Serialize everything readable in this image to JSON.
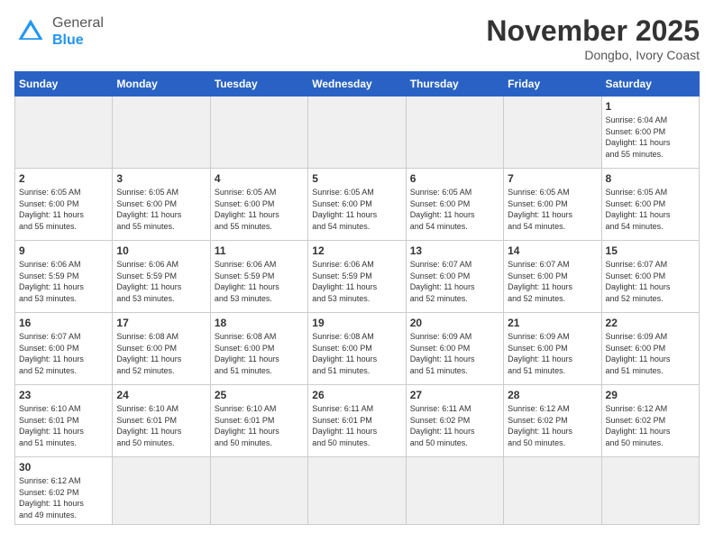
{
  "header": {
    "logo_general": "General",
    "logo_blue": "Blue",
    "month_title": "November 2025",
    "subtitle": "Dongbo, Ivory Coast"
  },
  "days_of_week": [
    "Sunday",
    "Monday",
    "Tuesday",
    "Wednesday",
    "Thursday",
    "Friday",
    "Saturday"
  ],
  "weeks": [
    [
      {
        "day": "",
        "info": "",
        "empty": true
      },
      {
        "day": "",
        "info": "",
        "empty": true
      },
      {
        "day": "",
        "info": "",
        "empty": true
      },
      {
        "day": "",
        "info": "",
        "empty": true
      },
      {
        "day": "",
        "info": "",
        "empty": true
      },
      {
        "day": "",
        "info": "",
        "empty": true
      },
      {
        "day": "1",
        "info": "Sunrise: 6:04 AM\nSunset: 6:00 PM\nDaylight: 11 hours\nand 55 minutes.",
        "empty": false
      }
    ],
    [
      {
        "day": "2",
        "info": "Sunrise: 6:05 AM\nSunset: 6:00 PM\nDaylight: 11 hours\nand 55 minutes.",
        "empty": false
      },
      {
        "day": "3",
        "info": "Sunrise: 6:05 AM\nSunset: 6:00 PM\nDaylight: 11 hours\nand 55 minutes.",
        "empty": false
      },
      {
        "day": "4",
        "info": "Sunrise: 6:05 AM\nSunset: 6:00 PM\nDaylight: 11 hours\nand 55 minutes.",
        "empty": false
      },
      {
        "day": "5",
        "info": "Sunrise: 6:05 AM\nSunset: 6:00 PM\nDaylight: 11 hours\nand 54 minutes.",
        "empty": false
      },
      {
        "day": "6",
        "info": "Sunrise: 6:05 AM\nSunset: 6:00 PM\nDaylight: 11 hours\nand 54 minutes.",
        "empty": false
      },
      {
        "day": "7",
        "info": "Sunrise: 6:05 AM\nSunset: 6:00 PM\nDaylight: 11 hours\nand 54 minutes.",
        "empty": false
      },
      {
        "day": "8",
        "info": "Sunrise: 6:05 AM\nSunset: 6:00 PM\nDaylight: 11 hours\nand 54 minutes.",
        "empty": false
      }
    ],
    [
      {
        "day": "9",
        "info": "Sunrise: 6:06 AM\nSunset: 5:59 PM\nDaylight: 11 hours\nand 53 minutes.",
        "empty": false
      },
      {
        "day": "10",
        "info": "Sunrise: 6:06 AM\nSunset: 5:59 PM\nDaylight: 11 hours\nand 53 minutes.",
        "empty": false
      },
      {
        "day": "11",
        "info": "Sunrise: 6:06 AM\nSunset: 5:59 PM\nDaylight: 11 hours\nand 53 minutes.",
        "empty": false
      },
      {
        "day": "12",
        "info": "Sunrise: 6:06 AM\nSunset: 5:59 PM\nDaylight: 11 hours\nand 53 minutes.",
        "empty": false
      },
      {
        "day": "13",
        "info": "Sunrise: 6:07 AM\nSunset: 6:00 PM\nDaylight: 11 hours\nand 52 minutes.",
        "empty": false
      },
      {
        "day": "14",
        "info": "Sunrise: 6:07 AM\nSunset: 6:00 PM\nDaylight: 11 hours\nand 52 minutes.",
        "empty": false
      },
      {
        "day": "15",
        "info": "Sunrise: 6:07 AM\nSunset: 6:00 PM\nDaylight: 11 hours\nand 52 minutes.",
        "empty": false
      }
    ],
    [
      {
        "day": "16",
        "info": "Sunrise: 6:07 AM\nSunset: 6:00 PM\nDaylight: 11 hours\nand 52 minutes.",
        "empty": false
      },
      {
        "day": "17",
        "info": "Sunrise: 6:08 AM\nSunset: 6:00 PM\nDaylight: 11 hours\nand 52 minutes.",
        "empty": false
      },
      {
        "day": "18",
        "info": "Sunrise: 6:08 AM\nSunset: 6:00 PM\nDaylight: 11 hours\nand 51 minutes.",
        "empty": false
      },
      {
        "day": "19",
        "info": "Sunrise: 6:08 AM\nSunset: 6:00 PM\nDaylight: 11 hours\nand 51 minutes.",
        "empty": false
      },
      {
        "day": "20",
        "info": "Sunrise: 6:09 AM\nSunset: 6:00 PM\nDaylight: 11 hours\nand 51 minutes.",
        "empty": false
      },
      {
        "day": "21",
        "info": "Sunrise: 6:09 AM\nSunset: 6:00 PM\nDaylight: 11 hours\nand 51 minutes.",
        "empty": false
      },
      {
        "day": "22",
        "info": "Sunrise: 6:09 AM\nSunset: 6:00 PM\nDaylight: 11 hours\nand 51 minutes.",
        "empty": false
      }
    ],
    [
      {
        "day": "23",
        "info": "Sunrise: 6:10 AM\nSunset: 6:01 PM\nDaylight: 11 hours\nand 51 minutes.",
        "empty": false
      },
      {
        "day": "24",
        "info": "Sunrise: 6:10 AM\nSunset: 6:01 PM\nDaylight: 11 hours\nand 50 minutes.",
        "empty": false
      },
      {
        "day": "25",
        "info": "Sunrise: 6:10 AM\nSunset: 6:01 PM\nDaylight: 11 hours\nand 50 minutes.",
        "empty": false
      },
      {
        "day": "26",
        "info": "Sunrise: 6:11 AM\nSunset: 6:01 PM\nDaylight: 11 hours\nand 50 minutes.",
        "empty": false
      },
      {
        "day": "27",
        "info": "Sunrise: 6:11 AM\nSunset: 6:02 PM\nDaylight: 11 hours\nand 50 minutes.",
        "empty": false
      },
      {
        "day": "28",
        "info": "Sunrise: 6:12 AM\nSunset: 6:02 PM\nDaylight: 11 hours\nand 50 minutes.",
        "empty": false
      },
      {
        "day": "29",
        "info": "Sunrise: 6:12 AM\nSunset: 6:02 PM\nDaylight: 11 hours\nand 50 minutes.",
        "empty": false
      }
    ],
    [
      {
        "day": "30",
        "info": "Sunrise: 6:12 AM\nSunset: 6:02 PM\nDaylight: 11 hours\nand 49 minutes.",
        "empty": false
      },
      {
        "day": "",
        "info": "",
        "empty": true
      },
      {
        "day": "",
        "info": "",
        "empty": true
      },
      {
        "day": "",
        "info": "",
        "empty": true
      },
      {
        "day": "",
        "info": "",
        "empty": true
      },
      {
        "day": "",
        "info": "",
        "empty": true
      },
      {
        "day": "",
        "info": "",
        "empty": true
      }
    ]
  ]
}
